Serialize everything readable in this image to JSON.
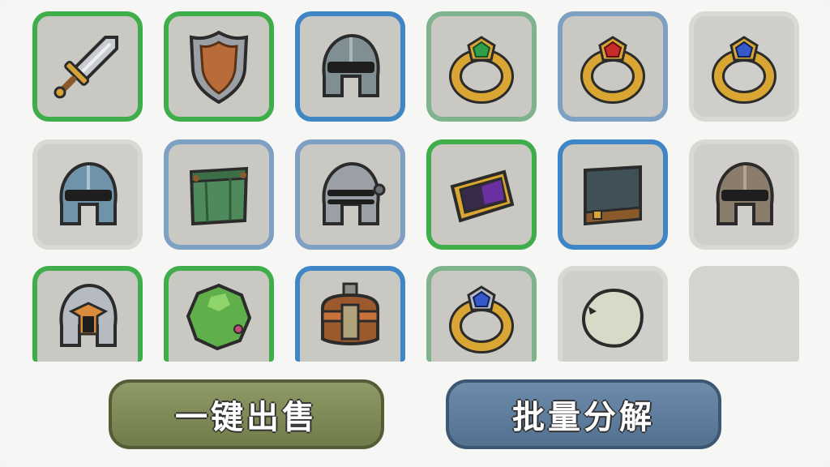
{
  "inventory": {
    "slots": [
      {
        "item": "sword-icon",
        "rarity": "green"
      },
      {
        "item": "shield-icon",
        "rarity": "green"
      },
      {
        "item": "helmet-icon",
        "rarity": "blue"
      },
      {
        "item": "emerald-ring-icon",
        "rarity": "sage"
      },
      {
        "item": "ruby-ring-icon",
        "rarity": "steel"
      },
      {
        "item": "sapphire-ring-icon",
        "rarity": "none"
      },
      {
        "item": "blue-helmet-icon",
        "rarity": "none"
      },
      {
        "item": "green-cloth-armor-icon",
        "rarity": "steel"
      },
      {
        "item": "knight-helmet-icon",
        "rarity": "steel"
      },
      {
        "item": "gold-bracer-icon",
        "rarity": "green"
      },
      {
        "item": "dark-cloth-armor-icon",
        "rarity": "blue"
      },
      {
        "item": "bronze-helmet-icon",
        "rarity": "none"
      },
      {
        "item": "gold-crest-helmet-icon",
        "rarity": "green"
      },
      {
        "item": "green-slime-orb-icon",
        "rarity": "green"
      },
      {
        "item": "leather-chestplate-icon",
        "rarity": "blue"
      },
      {
        "item": "sapphire-ring-icon",
        "rarity": "sage"
      },
      {
        "item": "pale-stone-icon",
        "rarity": "none"
      },
      {
        "item": "",
        "rarity": "empty"
      }
    ]
  },
  "actions": {
    "sell_all_label": "一键出售",
    "batch_salvage_label": "批量分解"
  },
  "colors": {
    "rarity_green": "#3fae4a",
    "rarity_blue": "#3f86c6",
    "rarity_steel": "#7ea0c2",
    "sell_button": "#7d8856",
    "salvage_button": "#5f7d9e"
  }
}
